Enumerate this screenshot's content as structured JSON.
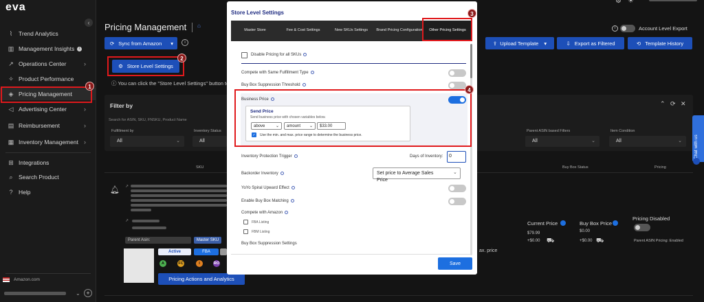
{
  "sidebar": {
    "items": [
      {
        "label": "Trend Analytics",
        "icon": "chart-icon"
      },
      {
        "label": "Management Insights",
        "icon": "bar-chart-icon"
      },
      {
        "label": "Operations Center",
        "icon": "trend-icon"
      },
      {
        "label": "Product Performance",
        "icon": "sparkle-icon"
      },
      {
        "label": "Pricing Management",
        "icon": "tag-icon"
      },
      {
        "label": "Advertising Center",
        "icon": "megaphone-icon"
      },
      {
        "label": "Reimbursement",
        "icon": "receipt-icon"
      },
      {
        "label": "Inventory Management",
        "icon": "inventory-icon"
      },
      {
        "label": "Integrations",
        "icon": "grid-icon"
      },
      {
        "label": "Search Product",
        "icon": "search-icon"
      },
      {
        "label": "Help",
        "icon": "help-icon"
      }
    ],
    "marketplace": "Amazon.com"
  },
  "header": {
    "title": "Pricing Management",
    "sync_button": "Sync from Amazon",
    "store_settings_button": "Store Level Settings",
    "hint_text": "You can click the \"Store Level Settings\" button to",
    "account_export": "Account Level Export",
    "upload_template": "Upload Template",
    "export_filtered": "Export as Filtered",
    "template_history": "Template History"
  },
  "filters": {
    "title": "Filter by",
    "search_placeholder": "Search for ASIN, SKU, FNSKU, Product Name",
    "fields": [
      {
        "label": "Fulfillment by",
        "value": "All"
      },
      {
        "label": "Inventory Status",
        "value": "All"
      },
      {
        "label": "Parent ASIN based Filters",
        "value": "All"
      },
      {
        "label": "Item Condition",
        "value": "All"
      }
    ]
  },
  "table": {
    "headers": [
      "SKU",
      "Buy Box Status",
      "Pricing"
    ],
    "row": {
      "current_price_label": "Current Price",
      "current_price": "$79.99",
      "current_price_extra": "+$0.00",
      "buy_box_price_label": "Buy Box Price",
      "buy_box_price": "$0.00",
      "buy_box_extra": "+$0.00",
      "pricing_disabled": "Pricing Disabled",
      "parent_asin_pricing": "Parent ASIN Pricing: Enabled",
      "parent_asin_tag": "Parent Asin:",
      "master_sku_tag": "Master SKU",
      "status_active": "Active",
      "status_fba": "FBA",
      "circles": [
        "A",
        "FC",
        "I",
        "RO"
      ],
      "partial_text": "ax. price",
      "action_button": "Pricing Actions and Analytics"
    }
  },
  "modal": {
    "title": "Store Level Settings",
    "tabs": [
      "Master Store",
      "Fee & Cost Settings",
      "New SKUs Settings",
      "Brand Pricing Configuration",
      "Other Pricing Settings"
    ],
    "active_tab": "Other Pricing Settings",
    "disable_pricing": "Disable Pricing for all SKUs",
    "compete_same": "Compete with Same Fulfillment Type",
    "buybox_threshold": "Buy Box Suppression Threshold",
    "business_price": "Business Price",
    "send_price_title": "Send Price",
    "send_price_desc": "Send business price with chosen variables below.",
    "send_price_dir": "above",
    "send_price_type": "amount",
    "send_price_value": "$33.00",
    "use_minmax": "Use the min. and max. price range to determine the business price.",
    "inventory_protection": "Inventory Protection Trigger",
    "days_of_inventory": "Days of Inventory:",
    "days_value": "0",
    "backorder": "Backorder Inventory",
    "backorder_value": "Set price to Average Sales Price",
    "yoyo": "YoYo Spiral Upward Effect",
    "buybox_matching": "Enable Buy Box Matching",
    "compete_amazon": "Compete with Amazon",
    "fba_listing": "FBA Listing",
    "fbm_listing": "FBM Listing",
    "buybox_suppression_settings": "Buy Box Suppression Settings",
    "save": "Save"
  },
  "markers": [
    "1",
    "2",
    "3",
    "4"
  ],
  "chat": "Chat with us",
  "colors": {
    "accent": "#1d4fb8",
    "annotation": "#e0191c",
    "toggle_on": "#1d6fe0"
  }
}
